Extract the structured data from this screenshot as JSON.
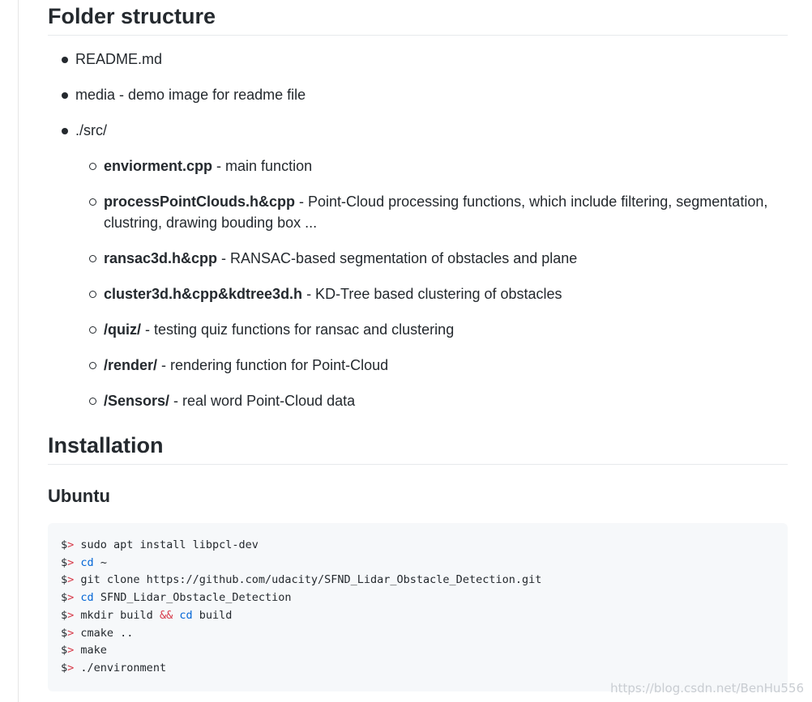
{
  "folder_section": {
    "title": "Folder structure",
    "items": [
      {
        "text": "README.md"
      },
      {
        "text": "media - demo image for readme file"
      },
      {
        "text": "./src/"
      }
    ],
    "src_items": [
      {
        "bold": "enviorment.cpp",
        "rest": " - main function"
      },
      {
        "bold": "processPointClouds.h&cpp",
        "rest": " - Point-Cloud processing functions, which include filtering, segmentation, clustring, drawing bouding box ..."
      },
      {
        "bold": "ransac3d.h&cpp",
        "rest": " - RANSAC-based segmentation of obstacles and plane"
      },
      {
        "bold": "cluster3d.h&cpp&kdtree3d.h",
        "rest": " - KD-Tree based clustering of obstacles"
      },
      {
        "bold": "/quiz/",
        "rest": " - testing quiz functions for ransac and clustering"
      },
      {
        "bold": "/render/",
        "rest": " - rendering function for Point-Cloud"
      },
      {
        "bold": "/Sensors/",
        "rest": " - real word Point-Cloud data"
      }
    ]
  },
  "install_section": {
    "title": "Installation",
    "subtitle": "Ubuntu",
    "prompt": "$",
    "prompt_gt": ">",
    "lines": [
      {
        "kw": "",
        "text": " sudo apt install libpcl-dev"
      },
      {
        "kw": "cd",
        "text": " ~"
      },
      {
        "kw": "",
        "text": " git clone https://github.com/udacity/SFND_Lidar_Obstacle_Detection.git"
      },
      {
        "kw": "cd",
        "text": " SFND_Lidar_Obstacle_Detection"
      },
      {
        "kw": "",
        "text": " mkdir build ",
        "op": "&&",
        "kw2": "cd",
        "text2": " build"
      },
      {
        "kw": "",
        "text": " cmake .."
      },
      {
        "kw": "",
        "text": " make"
      },
      {
        "kw": "",
        "text": " ./environment"
      }
    ]
  },
  "watermark": "https://blog.csdn.net/BenHu556"
}
